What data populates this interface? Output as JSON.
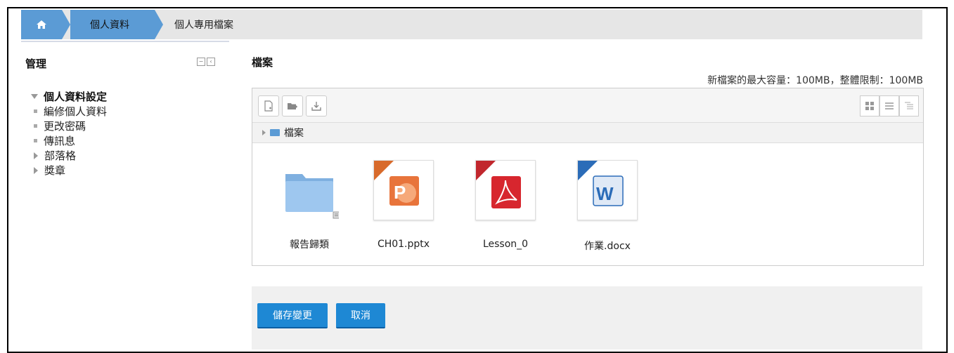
{
  "breadcrumb": {
    "home_icon": "home-icon",
    "items": [
      "個人資料",
      "個人專用檔案"
    ]
  },
  "sidebar": {
    "title": "管理",
    "root": "個人資料設定",
    "items": [
      "編修個人資料",
      "更改密碼",
      "傳訊息",
      "部落格",
      "獎章"
    ]
  },
  "main": {
    "title": "檔案",
    "limit_text": "新檔案的最大容量：100MB，整體限制：100MB",
    "path": "檔案",
    "files": [
      {
        "name": "報告歸類",
        "type": "folder"
      },
      {
        "name": "CH01.pptx",
        "type": "pptx"
      },
      {
        "name": "Lesson_0",
        "type": "pdf"
      },
      {
        "name": "作業.docx",
        "type": "docx"
      }
    ]
  },
  "buttons": {
    "save": "儲存變更",
    "cancel": "取消"
  },
  "colors": {
    "accent": "#5b9bd5",
    "button": "#1e88d4"
  }
}
